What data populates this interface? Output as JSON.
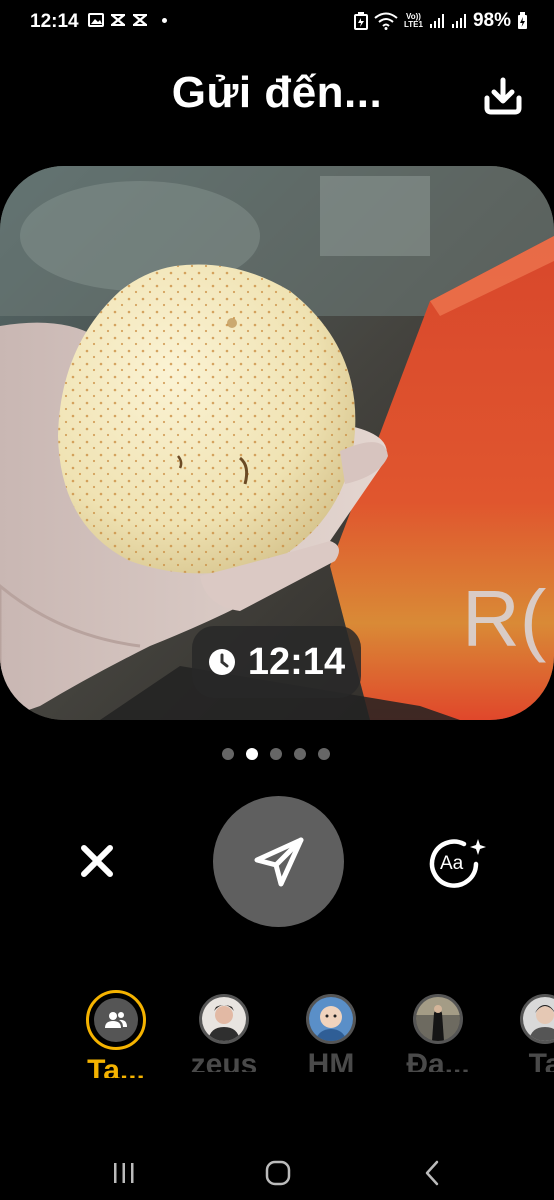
{
  "status_bar": {
    "time": "12:14",
    "battery": "98%",
    "network_label_top": "Vo))",
    "network_label_bottom": "LTE1"
  },
  "header": {
    "title": "Gửi đến...",
    "download_icon": "download-icon"
  },
  "photo": {
    "timestamp": "12:14",
    "box_text": "R("
  },
  "pager": {
    "count": 5,
    "active_index": 1
  },
  "controls": {
    "close_icon": "close-icon",
    "send_icon": "send-icon",
    "text_icon": "text-style-icon",
    "text_icon_label": "Aa"
  },
  "recipients": [
    {
      "name": "Ta...",
      "selected": true
    },
    {
      "name": "zeus",
      "selected": false
    },
    {
      "name": "HM",
      "selected": false
    },
    {
      "name": "Đạ...",
      "selected": false
    },
    {
      "name": "Ta",
      "selected": false
    }
  ],
  "colors": {
    "accent": "#f5b300",
    "background": "#000000",
    "send_button": "#5f5f5f"
  }
}
